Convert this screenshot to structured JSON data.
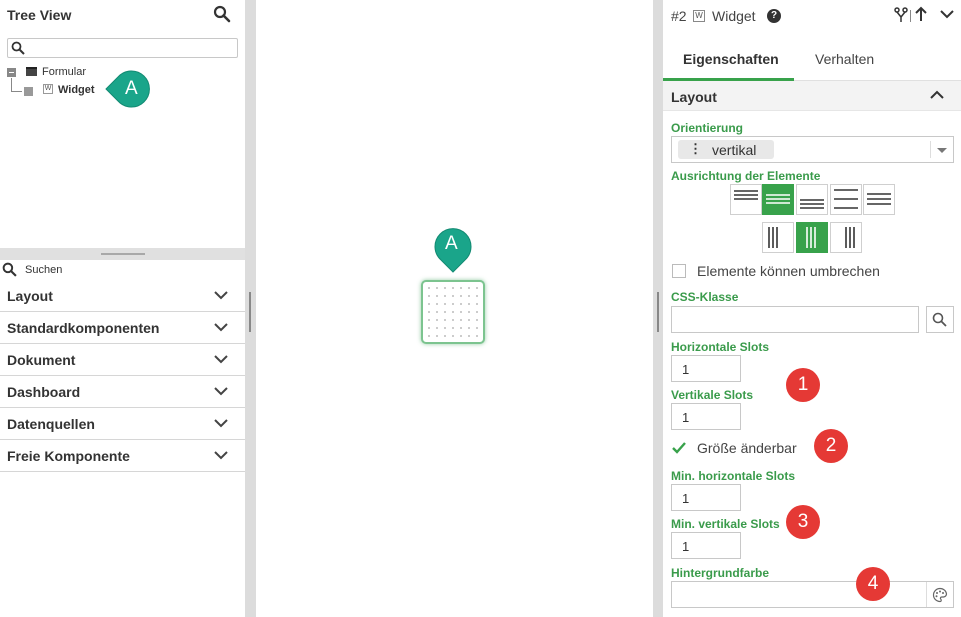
{
  "tree": {
    "title": "Tree View",
    "nodes": [
      {
        "label": "Formular",
        "type_letter": ""
      },
      {
        "label": "Widget",
        "type_letter": "W"
      }
    ],
    "marker": "A"
  },
  "palette": {
    "search_placeholder": "Suchen",
    "categories": [
      "Layout",
      "Standardkomponenten",
      "Dokument",
      "Dashboard",
      "Datenquellen",
      "Freie Komponente"
    ]
  },
  "canvas": {
    "marker": "A"
  },
  "props": {
    "header": {
      "id": "#2",
      "type_letter": "W",
      "name": "Widget",
      "help": "?"
    },
    "tabs": [
      "Eigenschaften",
      "Verhalten"
    ],
    "section": "Layout",
    "orientation_label": "Orientierung",
    "orientation_value": "vertikal",
    "alignment_label": "Ausrichtung der Elemente",
    "wrap_label": "Elemente können umbrechen",
    "wrap_checked": false,
    "css_label": "CSS-Klasse",
    "css_value": "",
    "hslots_label": "Horizontale Slots",
    "hslots_value": "1",
    "vslots_label": "Vertikale Slots",
    "vslots_value": "1",
    "resizable_label": "Größe änderbar",
    "resizable_checked": true,
    "min_hslots_label": "Min. horizontale Slots",
    "min_hslots_value": "1",
    "min_vslots_label": "Min. vertikale Slots",
    "min_vslots_value": "1",
    "bgcolor_label": "Hintergrundfarbe",
    "bgcolor_value": ""
  },
  "badges": [
    "1",
    "2",
    "3",
    "4"
  ],
  "colors": {
    "accent_green": "#38a24b",
    "marker_teal": "#1aa58a",
    "badge_red": "#e53935"
  }
}
